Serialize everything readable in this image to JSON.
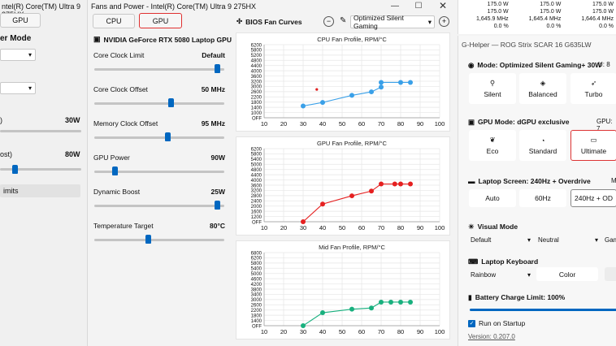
{
  "left_window": {
    "title": "ntel(R) Core(TM) Ultra 9 275HX",
    "gpu_tab": "GPU",
    "power_mode_label": "er Mode",
    "label1": ")",
    "value1": "30W",
    "label2": "ost)",
    "value2": "80W",
    "limits_button": "imits"
  },
  "main_window": {
    "title": "Fans and Power - Intel(R) Core(TM) Ultra 9 275HX",
    "tabs": [
      "CPU",
      "GPU"
    ],
    "gpu_name": "NVIDIA GeForce RTX 5080 Laptop GPU",
    "bios_title": "BIOS Fan Curves",
    "mode_select": "Optimized Silent Gaming",
    "sliders": [
      {
        "label": "Core Clock Limit",
        "value": "Default",
        "pos": 0.97
      },
      {
        "label": "Core Clock Offset",
        "value": "50 MHz",
        "pos": 0.6
      },
      {
        "label": "Memory Clock Offset",
        "value": "95 MHz",
        "pos": 0.58
      },
      {
        "label": "GPU Power",
        "value": "90W",
        "pos": 0.16
      },
      {
        "label": "Dynamic Boost",
        "value": "25W",
        "pos": 0.97
      },
      {
        "label": "Temperature Target",
        "value": "80°C",
        "pos": 0.42
      }
    ]
  },
  "chart_data": [
    {
      "type": "line",
      "title": "CPU Fan Profile, RPM/°C",
      "color": "#3aa0e8",
      "x": [
        30,
        40,
        55,
        65,
        70,
        70,
        80,
        85
      ],
      "y": [
        1000,
        1300,
        1900,
        2200,
        2600,
        3000,
        3000,
        3000
      ],
      "xlim": [
        10,
        100
      ],
      "xticks": [
        "10",
        "20",
        "30",
        "40",
        "50",
        "60",
        "70",
        "80",
        "90",
        "100"
      ],
      "yticks": [
        "6200",
        "5800",
        "5200",
        "4800",
        "4400",
        "4000",
        "3600",
        "3200",
        "3000",
        "2600",
        "2200",
        "1800",
        "1400",
        "1000",
        "OFF"
      ],
      "extra_point": {
        "x": 37,
        "y": 2400,
        "color": "#e02020"
      }
    },
    {
      "type": "line",
      "title": "GPU Fan Profile, RPM/°C",
      "color": "#e52020",
      "x": [
        30,
        40,
        55,
        65,
        70,
        77,
        80,
        85
      ],
      "y": [
        0,
        1500,
        2200,
        2600,
        3200,
        3200,
        3200,
        3200
      ],
      "xlim": [
        10,
        100
      ],
      "xticks": [
        "10",
        "20",
        "30",
        "40",
        "50",
        "60",
        "70",
        "80",
        "90",
        "100"
      ],
      "yticks": [
        "6200",
        "5800",
        "5400",
        "5000",
        "4800",
        "4400",
        "4000",
        "3600",
        "3200",
        "2800",
        "2400",
        "2000",
        "1600",
        "1200",
        "OFF"
      ]
    },
    {
      "type": "line",
      "title": "Mid Fan Profile, RPM/°C",
      "color": "#18b07e",
      "x": [
        30,
        40,
        55,
        65,
        70,
        75,
        80,
        85
      ],
      "y": [
        0,
        1100,
        1400,
        1500,
        2000,
        2000,
        2000,
        2000
      ],
      "xlim": [
        10,
        100
      ],
      "xticks": [
        "10",
        "20",
        "30",
        "40",
        "50",
        "60",
        "70",
        "80",
        "90",
        "100"
      ],
      "yticks": [
        "6800",
        "6200",
        "5800",
        "5400",
        "5000",
        "4600",
        "4200",
        "3800",
        "3400",
        "3000",
        "2600",
        "2200",
        "1800",
        "1400",
        "OFF"
      ]
    }
  ],
  "table_strip": {
    "rows": [
      [
        "175.0 W",
        "175.0 W",
        "175.0 W"
      ],
      [
        "175.0 W",
        "175.0 W",
        "175.0 W"
      ],
      [
        "1,645.9 MHz",
        "1,645.4 MHz",
        "1,646.4 MHz"
      ],
      [
        "0.0 %",
        "0.0 %",
        "0.0 %"
      ]
    ]
  },
  "ghelper": {
    "title": "G-Helper — ROG Strix SCAR 16 G635LW",
    "mode_heading": "Mode: Optimized Silent Gaming+ 30W",
    "mode_extra": "U: 8",
    "modes": [
      "Silent",
      "Balanced",
      "Turbo"
    ],
    "gpu_heading": "GPU Mode: dGPU exclusive",
    "gpu_extra": "GPU: 7",
    "gpu_modes": [
      "Eco",
      "Standard",
      "Ultimate"
    ],
    "screen_heading": "Laptop Screen: 240Hz + Overdrive",
    "screen_extra": "M",
    "screen_modes": [
      "Auto",
      "60Hz",
      "240Hz + OD"
    ],
    "visual_heading": "Visual Mode",
    "visual_values": [
      "Default",
      "Neutral",
      "Gam"
    ],
    "keyboard_heading": "Laptop Keyboard",
    "keyboard_mode": "Rainbow",
    "keyboard_color": "Color",
    "battery_heading": "Battery Charge Limit: 100%",
    "startup_label": "Run on Startup",
    "version": "Version: 0.207.0"
  }
}
